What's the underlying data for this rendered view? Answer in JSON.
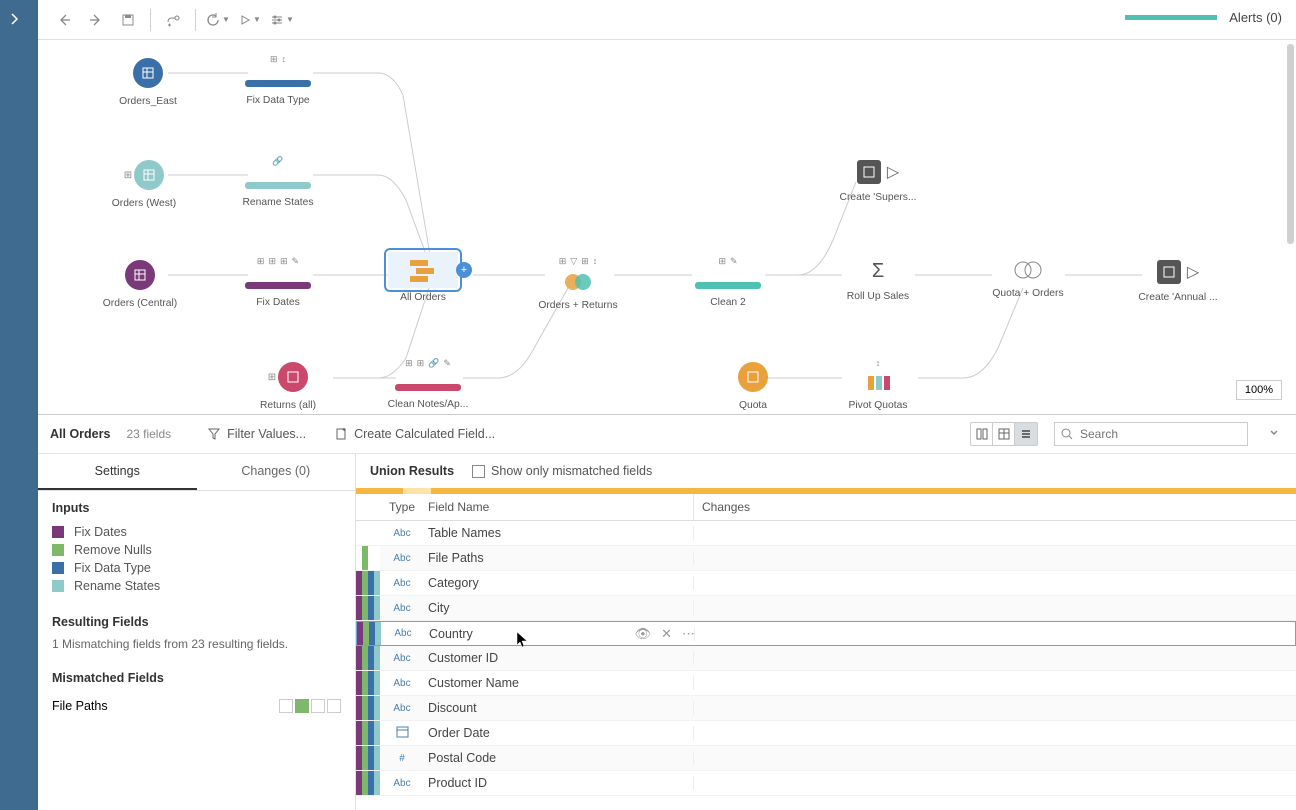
{
  "toolbar": {
    "alerts_label": "Alerts (0)",
    "zoom": "100%"
  },
  "flow": {
    "nodes": {
      "orders_east": "Orders_East",
      "fix_data_type": "Fix Data Type",
      "orders_west": "Orders (West)",
      "rename_states": "Rename States",
      "orders_central": "Orders (Central)",
      "fix_dates": "Fix Dates",
      "all_orders": "All Orders",
      "orders_returns": "Orders + Returns",
      "clean2": "Clean 2",
      "rollup": "Roll Up Sales",
      "quota_orders": "Quota + Orders",
      "create_annual": "Create 'Annual ...",
      "create_supers": "Create 'Supers...",
      "returns_all": "Returns (all)",
      "clean_notes": "Clean Notes/Ap...",
      "quota": "Quota",
      "pivot_quotas": "Pivot Quotas"
    }
  },
  "profile": {
    "title": "All Orders",
    "fields_count": "23 fields",
    "filter_label": "Filter Values...",
    "calc_label": "Create Calculated Field...",
    "search_placeholder": "Search"
  },
  "left": {
    "tab_settings": "Settings",
    "tab_changes": "Changes (0)",
    "inputs_heading": "Inputs",
    "inputs": [
      {
        "color": "#7a3a7a",
        "label": "Fix Dates"
      },
      {
        "color": "#7db86b",
        "label": "Remove Nulls"
      },
      {
        "color": "#3a6fa8",
        "label": "Fix Data Type"
      },
      {
        "color": "#8fc9c9",
        "label": "Rename States"
      }
    ],
    "resulting_heading": "Resulting Fields",
    "resulting_text": "1 Mismatching fields from 23 resulting fields.",
    "mismatched_heading": "Mismatched Fields",
    "mismatched_field": "File Paths"
  },
  "right": {
    "union_title": "Union Results",
    "show_mismatch": "Show only mismatched fields",
    "col_type": "Type",
    "col_name": "Field Name",
    "col_changes": "Changes",
    "rows": [
      {
        "type": "Abc",
        "name": "Table Names",
        "stripes": [
          "#fff",
          "#fff",
          "#fff",
          "#fff"
        ]
      },
      {
        "type": "Abc",
        "name": "File Paths",
        "stripes": [
          "#fff",
          "#7db86b",
          "#fff",
          "#fff"
        ]
      },
      {
        "type": "Abc",
        "name": "Category",
        "stripes": [
          "#7a3a7a",
          "#7db86b",
          "#3a6fa8",
          "#8fc9c9"
        ]
      },
      {
        "type": "Abc",
        "name": "City",
        "stripes": [
          "#7a3a7a",
          "#7db86b",
          "#3a6fa8",
          "#8fc9c9"
        ]
      },
      {
        "type": "Abc",
        "name": "Country",
        "stripes": [
          "#7a3a7a",
          "#7db86b",
          "#3a6fa8",
          "#8fc9c9"
        ],
        "hovered": true
      },
      {
        "type": "Abc",
        "name": "Customer ID",
        "stripes": [
          "#7a3a7a",
          "#7db86b",
          "#3a6fa8",
          "#8fc9c9"
        ]
      },
      {
        "type": "Abc",
        "name": "Customer Name",
        "stripes": [
          "#7a3a7a",
          "#7db86b",
          "#3a6fa8",
          "#8fc9c9"
        ]
      },
      {
        "type": "Abc",
        "name": "Discount",
        "stripes": [
          "#7a3a7a",
          "#7db86b",
          "#3a6fa8",
          "#8fc9c9"
        ]
      },
      {
        "type": "date",
        "name": "Order Date",
        "stripes": [
          "#7a3a7a",
          "#7db86b",
          "#3a6fa8",
          "#8fc9c9"
        ]
      },
      {
        "type": "#",
        "name": "Postal Code",
        "stripes": [
          "#7a3a7a",
          "#7db86b",
          "#3a6fa8",
          "#8fc9c9"
        ]
      },
      {
        "type": "Abc",
        "name": "Product ID",
        "stripes": [
          "#7a3a7a",
          "#7db86b",
          "#3a6fa8",
          "#8fc9c9"
        ]
      }
    ]
  }
}
